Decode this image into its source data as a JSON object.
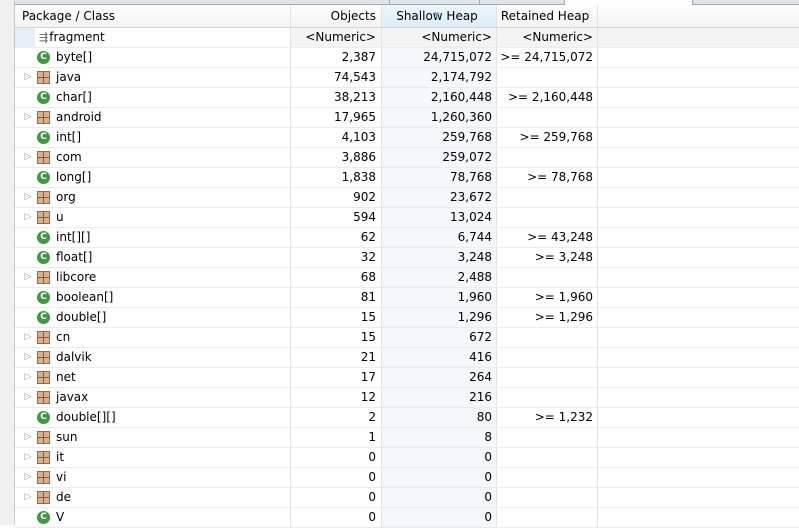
{
  "columns": [
    "Package / Class",
    "Objects",
    "Shallow Heap",
    "Retained Heap"
  ],
  "filter": {
    "name": "fragment",
    "objects": "<Numeric>",
    "shallow": "<Numeric>",
    "retained": "<Numeric>"
  },
  "rows": [
    {
      "name": "byte[]",
      "type": "class",
      "objects": "2,387",
      "shallow": "24,715,072",
      "retained": ">= 24,715,072"
    },
    {
      "name": "java",
      "type": "package",
      "objects": "74,543",
      "shallow": "2,174,792",
      "retained": ""
    },
    {
      "name": "char[]",
      "type": "class",
      "objects": "38,213",
      "shallow": "2,160,448",
      "retained": ">= 2,160,448"
    },
    {
      "name": "android",
      "type": "package",
      "objects": "17,965",
      "shallow": "1,260,360",
      "retained": ""
    },
    {
      "name": "int[]",
      "type": "class",
      "objects": "4,103",
      "shallow": "259,768",
      "retained": ">= 259,768"
    },
    {
      "name": "com",
      "type": "package",
      "objects": "3,886",
      "shallow": "259,072",
      "retained": ""
    },
    {
      "name": "long[]",
      "type": "class",
      "objects": "1,838",
      "shallow": "78,768",
      "retained": ">= 78,768"
    },
    {
      "name": "org",
      "type": "package",
      "objects": "902",
      "shallow": "23,672",
      "retained": ""
    },
    {
      "name": "u",
      "type": "package",
      "objects": "594",
      "shallow": "13,024",
      "retained": ""
    },
    {
      "name": "int[][]",
      "type": "class",
      "objects": "62",
      "shallow": "6,744",
      "retained": ">= 43,248"
    },
    {
      "name": "float[]",
      "type": "class",
      "objects": "32",
      "shallow": "3,248",
      "retained": ">= 3,248"
    },
    {
      "name": "libcore",
      "type": "package",
      "objects": "68",
      "shallow": "2,488",
      "retained": ""
    },
    {
      "name": "boolean[]",
      "type": "class",
      "objects": "81",
      "shallow": "1,960",
      "retained": ">= 1,960"
    },
    {
      "name": "double[]",
      "type": "class",
      "objects": "15",
      "shallow": "1,296",
      "retained": ">= 1,296"
    },
    {
      "name": "cn",
      "type": "package",
      "objects": "15",
      "shallow": "672",
      "retained": ""
    },
    {
      "name": "dalvik",
      "type": "package",
      "objects": "21",
      "shallow": "416",
      "retained": ""
    },
    {
      "name": "net",
      "type": "package",
      "objects": "17",
      "shallow": "264",
      "retained": ""
    },
    {
      "name": "javax",
      "type": "package",
      "objects": "12",
      "shallow": "216",
      "retained": ""
    },
    {
      "name": "double[][]",
      "type": "class",
      "objects": "2",
      "shallow": "80",
      "retained": ">= 1,232"
    },
    {
      "name": "sun",
      "type": "package",
      "objects": "1",
      "shallow": "8",
      "retained": ""
    },
    {
      "name": "it",
      "type": "package",
      "objects": "0",
      "shallow": "0",
      "retained": ""
    },
    {
      "name": "vi",
      "type": "package",
      "objects": "0",
      "shallow": "0",
      "retained": ""
    },
    {
      "name": "de",
      "type": "package",
      "objects": "0",
      "shallow": "0",
      "retained": ""
    },
    {
      "name": "V",
      "type": "class",
      "objects": "0",
      "shallow": "0",
      "retained": ""
    }
  ],
  "colors": {
    "class_icon": "#3d9a3d",
    "package_icon": "#d9b08a",
    "sorted_header": "#dcecf8"
  }
}
